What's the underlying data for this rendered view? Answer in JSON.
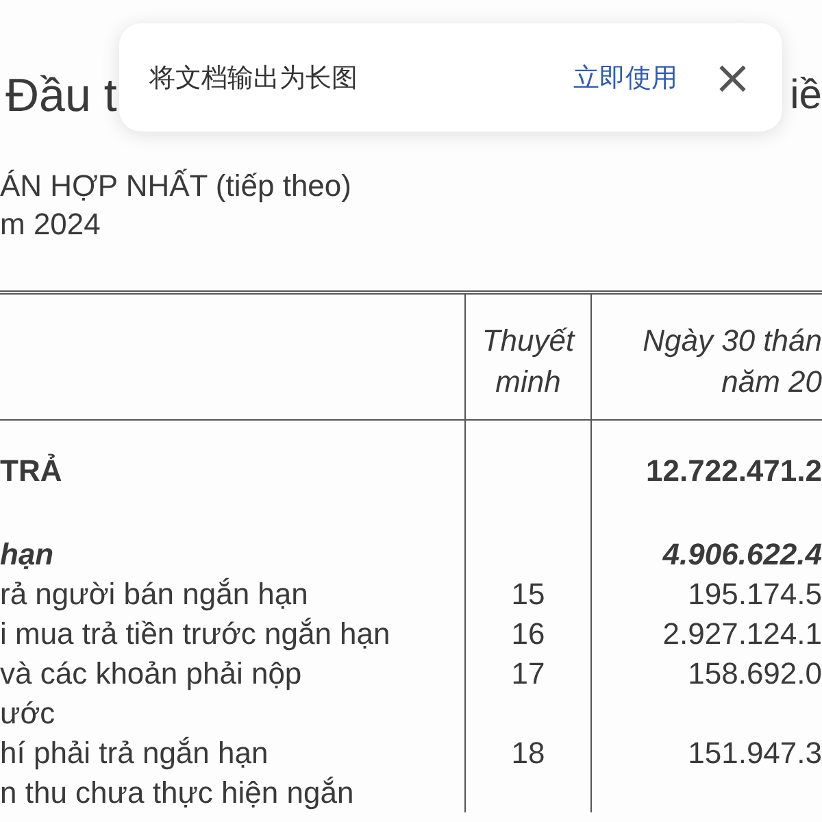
{
  "document": {
    "heading_left": "Đầu t",
    "heading_right": "iề",
    "subtitle_lines": [
      "ÁN HỢP NHẤT (tiếp theo)",
      "m 2024"
    ],
    "table": {
      "columns": [
        {
          "lines": [
            "Thuyết",
            "minh"
          ]
        },
        {
          "lines": [
            "Ngày 30 thán",
            "năm 20"
          ]
        }
      ],
      "rows": [
        {
          "kind": "total",
          "label_lines": [
            "TRẢ"
          ],
          "note": "",
          "value": "12.722.471.2"
        },
        {
          "kind": "section",
          "label_lines": [
            "hạn"
          ],
          "note": "",
          "value": "4.906.622.4"
        },
        {
          "kind": "item",
          "label_lines": [
            "rả người bán ngắn hạn"
          ],
          "note": "15",
          "value": "195.174.5"
        },
        {
          "kind": "item",
          "label_lines": [
            "i mua trả tiền trước ngắn hạn"
          ],
          "note": "16",
          "value": "2.927.124.1"
        },
        {
          "kind": "item",
          "label_lines": [
            "và các khoản phải nộp",
            "ước"
          ],
          "note": "17",
          "value": "158.692.0"
        },
        {
          "kind": "item",
          "label_lines": [
            "hí phải trả ngắn hạn"
          ],
          "note": "18",
          "value": "151.947.3"
        },
        {
          "kind": "item",
          "label_lines": [
            "n thu chưa thực hiện ngắn"
          ],
          "note": "",
          "value": ""
        }
      ]
    }
  },
  "banner": {
    "message": "将文档输出为长图",
    "action": "立即使用",
    "close": "×"
  }
}
